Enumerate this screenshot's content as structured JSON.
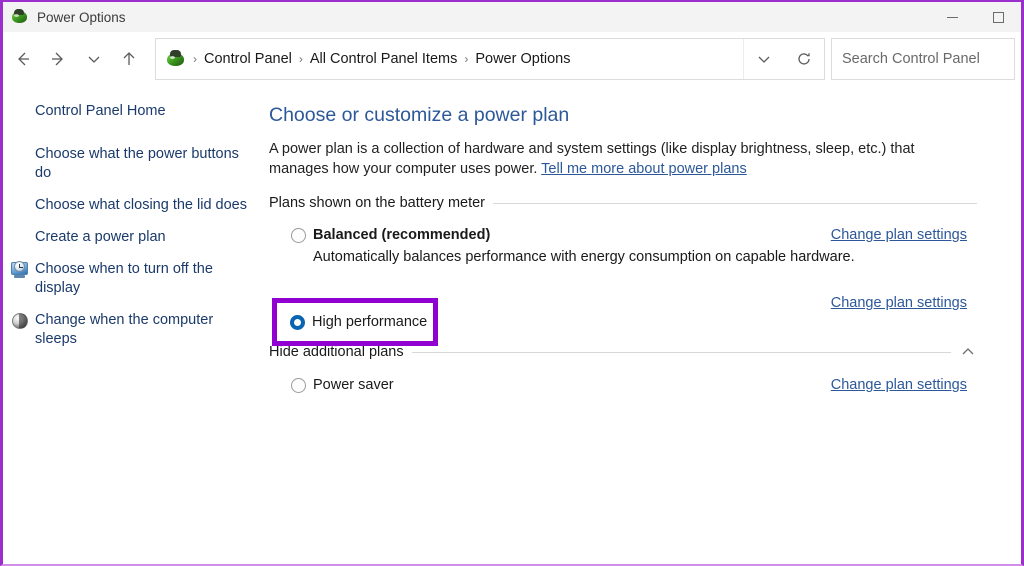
{
  "window": {
    "title": "Power Options",
    "icon": "power-plug-icon",
    "buttons": {
      "minimize": "minimize-icon",
      "maximize": "maximize-icon"
    }
  },
  "toolbar": {
    "back": "back-arrow-icon",
    "forward": "forward-arrow-icon",
    "recent": "chevron-down-icon",
    "up": "up-arrow-icon",
    "refresh": "refresh-icon",
    "dropdown": "chevron-down-icon"
  },
  "address": {
    "icon": "power-plug-icon",
    "separator": "›",
    "crumbs": [
      "Control Panel",
      "All Control Panel Items",
      "Power Options"
    ]
  },
  "search": {
    "placeholder": "Search Control Panel",
    "value": ""
  },
  "sidebar": {
    "items": [
      {
        "label": "Control Panel Home",
        "icon": null
      },
      {
        "label": "Choose what the power buttons do",
        "icon": null
      },
      {
        "label": "Choose what closing the lid does",
        "icon": null
      },
      {
        "label": "Create a power plan",
        "icon": null
      },
      {
        "label": "Choose when to turn off the display",
        "icon": "display-clock-icon"
      },
      {
        "label": "Change when the computer sleeps",
        "icon": "sleep-orb-icon"
      }
    ]
  },
  "main": {
    "title": "Choose or customize a power plan",
    "description_part1": "A power plan is a collection of hardware and system settings (like display brightness, sleep, etc.) that manages how your computer uses power. ",
    "description_link": "Tell me more about power plans",
    "sections": [
      {
        "label": "Plans shown on the battery meter",
        "chevron": null
      },
      {
        "label": "Hide additional plans",
        "chevron": "chevron-up-icon"
      }
    ],
    "plans": [
      {
        "name": "Balanced (recommended)",
        "selected": false,
        "bold": true,
        "description": "Automatically balances performance with energy consumption on capable hardware.",
        "link": "Change plan settings"
      },
      {
        "name": "High performance",
        "selected": true,
        "bold": false,
        "description": "",
        "link": "Change plan settings"
      },
      {
        "name": "Power saver",
        "selected": false,
        "bold": false,
        "description": "",
        "link": "Change plan settings"
      }
    ]
  },
  "annotation": {
    "highlight_color": "#9000d0",
    "border_color": "#9b2fce",
    "target": "High performance"
  }
}
